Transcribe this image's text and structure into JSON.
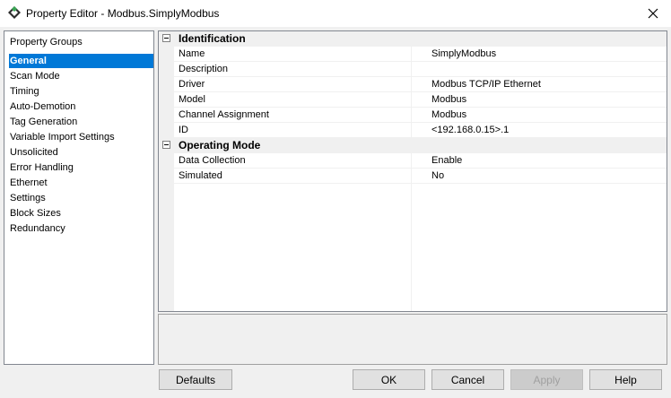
{
  "window": {
    "title": "Property Editor - Modbus.SimplyModbus",
    "icon": "kepware-diamond-icon",
    "close_icon": "close-icon"
  },
  "groups": {
    "header": "Property Groups",
    "items": [
      {
        "label": "General",
        "selected": true
      },
      {
        "label": "Scan Mode"
      },
      {
        "label": "Timing"
      },
      {
        "label": "Auto-Demotion"
      },
      {
        "label": "Tag Generation"
      },
      {
        "label": "Variable Import Settings"
      },
      {
        "label": "Unsolicited"
      },
      {
        "label": "Error Handling"
      },
      {
        "label": "Ethernet"
      },
      {
        "label": "Settings"
      },
      {
        "label": "Block Sizes"
      },
      {
        "label": "Redundancy"
      }
    ]
  },
  "grid": {
    "categories": [
      {
        "name": "Identification",
        "rows": [
          {
            "name": "Name",
            "value": "SimplyModbus"
          },
          {
            "name": "Description",
            "value": ""
          },
          {
            "name": "Driver",
            "value": "Modbus TCP/IP Ethernet"
          },
          {
            "name": "Model",
            "value": "Modbus"
          },
          {
            "name": "Channel Assignment",
            "value": "Modbus"
          },
          {
            "name": "ID",
            "value": "<192.168.0.15>.1"
          }
        ]
      },
      {
        "name": "Operating Mode",
        "rows": [
          {
            "name": "Data Collection",
            "value": "Enable"
          },
          {
            "name": "Simulated",
            "value": "No"
          }
        ]
      }
    ]
  },
  "buttons": {
    "defaults": "Defaults",
    "ok": "OK",
    "cancel": "Cancel",
    "apply": "Apply",
    "help": "Help"
  }
}
